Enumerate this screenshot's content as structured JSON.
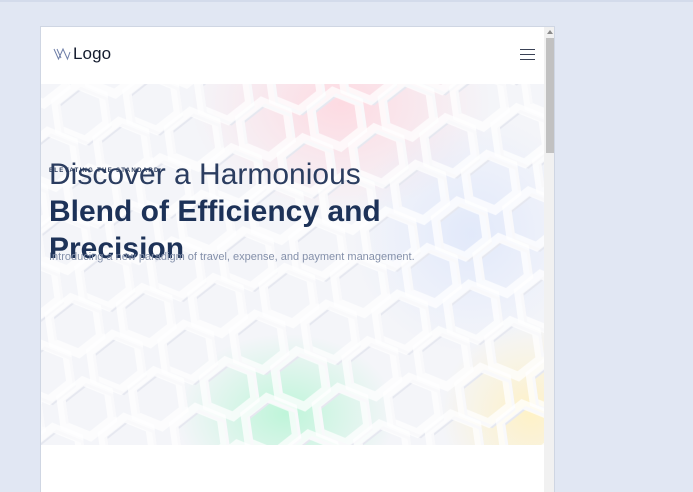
{
  "nav": {
    "logo_text": "Logo",
    "logo_icon": "logo-mark-icon",
    "menu_icon": "hamburger-menu-icon"
  },
  "hero": {
    "eyebrow": "ELEVATING THE STANDARD:",
    "headline_light": "Discover a Harmonious",
    "headline_bold": "Blend of Efficiency and Precision",
    "subtext": "Introducing a new paradigm of travel, expense, and payment management."
  },
  "colors": {
    "page_background": "#e1e7f3",
    "headline": "#1f3357",
    "subtext": "#8490aa"
  }
}
